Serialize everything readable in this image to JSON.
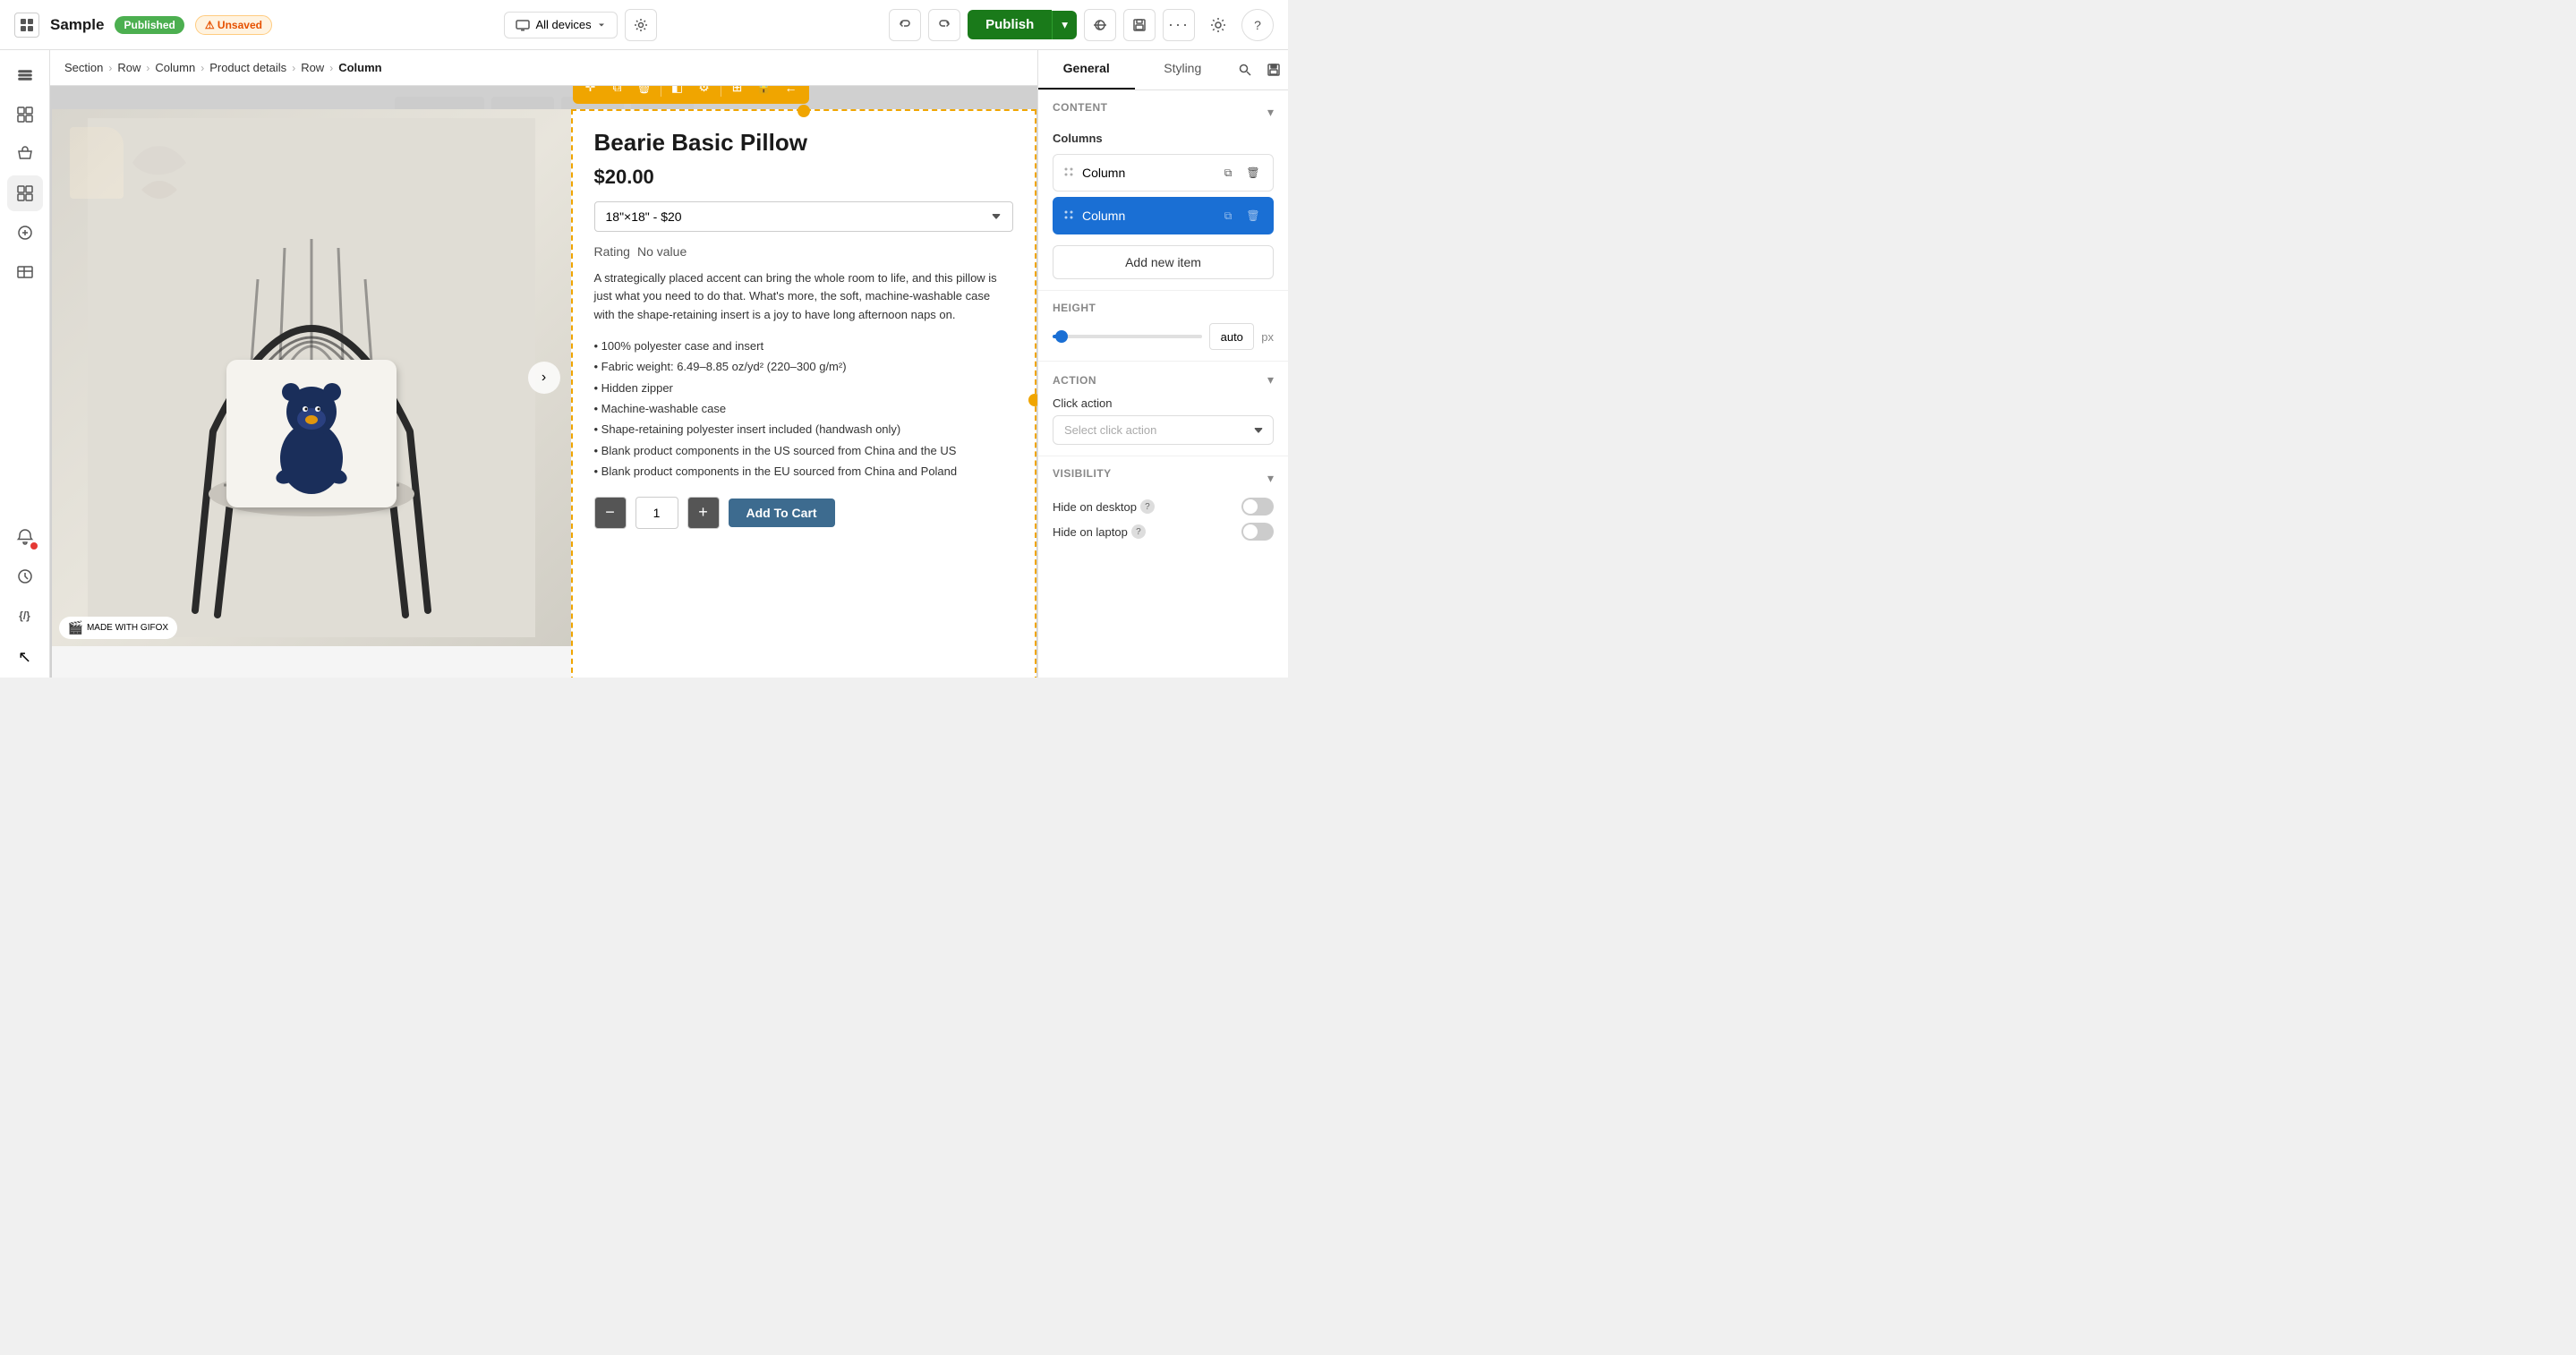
{
  "topbar": {
    "app_icon": "◫",
    "page_name": "Sample",
    "badge_published": "Published",
    "badge_unsaved": "⚠ Unsaved",
    "device_selector": "All devices",
    "undo_icon": "↩",
    "redo_icon": "↪",
    "publish_label": "Publish",
    "publish_arrow": "▾",
    "preview_icon": "👁",
    "save_icon": "⊡",
    "more_icon": "···",
    "gear_icon": "⚙",
    "help_icon": "?"
  },
  "breadcrumb": {
    "items": [
      "Section",
      "Row",
      "Column",
      "Product details",
      "Row",
      "Column"
    ]
  },
  "canvas": {
    "top_bars": [
      "bar1",
      "bar2",
      "bar3"
    ]
  },
  "product": {
    "title": "Bearie Basic Pillow",
    "price": "$20.00",
    "variant": "18\"×18\" - $20",
    "rating_label": "Rating",
    "rating_value": "No value",
    "description": "A strategically placed accent can bring the whole room to life, and this pillow is just what you need to do that. What's more, the soft, machine-washable case with the shape-retaining insert is a joy to have long afternoon naps on.",
    "features": [
      "100% polyester case and insert",
      "Fabric weight: 6.49–8.85 oz/yd² (220–300 g/m²)",
      "Hidden zipper",
      "Machine-washable case",
      "Shape-retaining polyester insert included (handwash only)",
      "Blank product components in the US sourced from China and the US",
      "Blank product components in the EU sourced from China and Poland"
    ],
    "qty": "1",
    "add_to_cart": "Add To Cart",
    "carousel_arrow": "›",
    "watermark": "MADE WITH GIFOX"
  },
  "toolbar": {
    "move_icon": "✛",
    "copy_icon": "⧉",
    "delete_icon": "🗑",
    "left_icon": "◧",
    "settings_icon": "⚙",
    "duplicate_icon": "⊞",
    "lock_icon": "🔒",
    "arrow_icon": "←"
  },
  "right_panel": {
    "tabs": [
      "General",
      "Styling"
    ],
    "search_icon": "🔍",
    "save_icon": "💾",
    "content_section": "CONTENT",
    "columns_section": "Columns",
    "columns": [
      {
        "label": "Column",
        "active": false
      },
      {
        "label": "Column",
        "active": true
      }
    ],
    "copy_icon": "⧉",
    "delete_icon": "🗑",
    "add_new_item": "Add new item",
    "height_section": "Height",
    "height_value": "auto",
    "height_unit": "px",
    "action_section": "ACTION",
    "click_action_label": "Click action",
    "click_action_placeholder": "Select click action",
    "visibility_section": "VISIBILITY",
    "hide_desktop_label": "Hide on desktop",
    "hide_laptop_label": "Hide on laptop",
    "help_icon": "?"
  },
  "sidebar": {
    "icons": [
      {
        "name": "menu-icon",
        "glyph": "☰"
      },
      {
        "name": "layers-icon",
        "glyph": "◫"
      },
      {
        "name": "shop-icon",
        "glyph": "🛍"
      },
      {
        "name": "grid-icon",
        "glyph": "⊞"
      },
      {
        "name": "add-section-icon",
        "glyph": "⊕"
      },
      {
        "name": "table-icon",
        "glyph": "⊟"
      },
      {
        "name": "notification-icon",
        "glyph": "🔴",
        "has_dot": true
      },
      {
        "name": "history-icon",
        "glyph": "🕐"
      },
      {
        "name": "code-icon",
        "glyph": "{/}"
      }
    ]
  }
}
